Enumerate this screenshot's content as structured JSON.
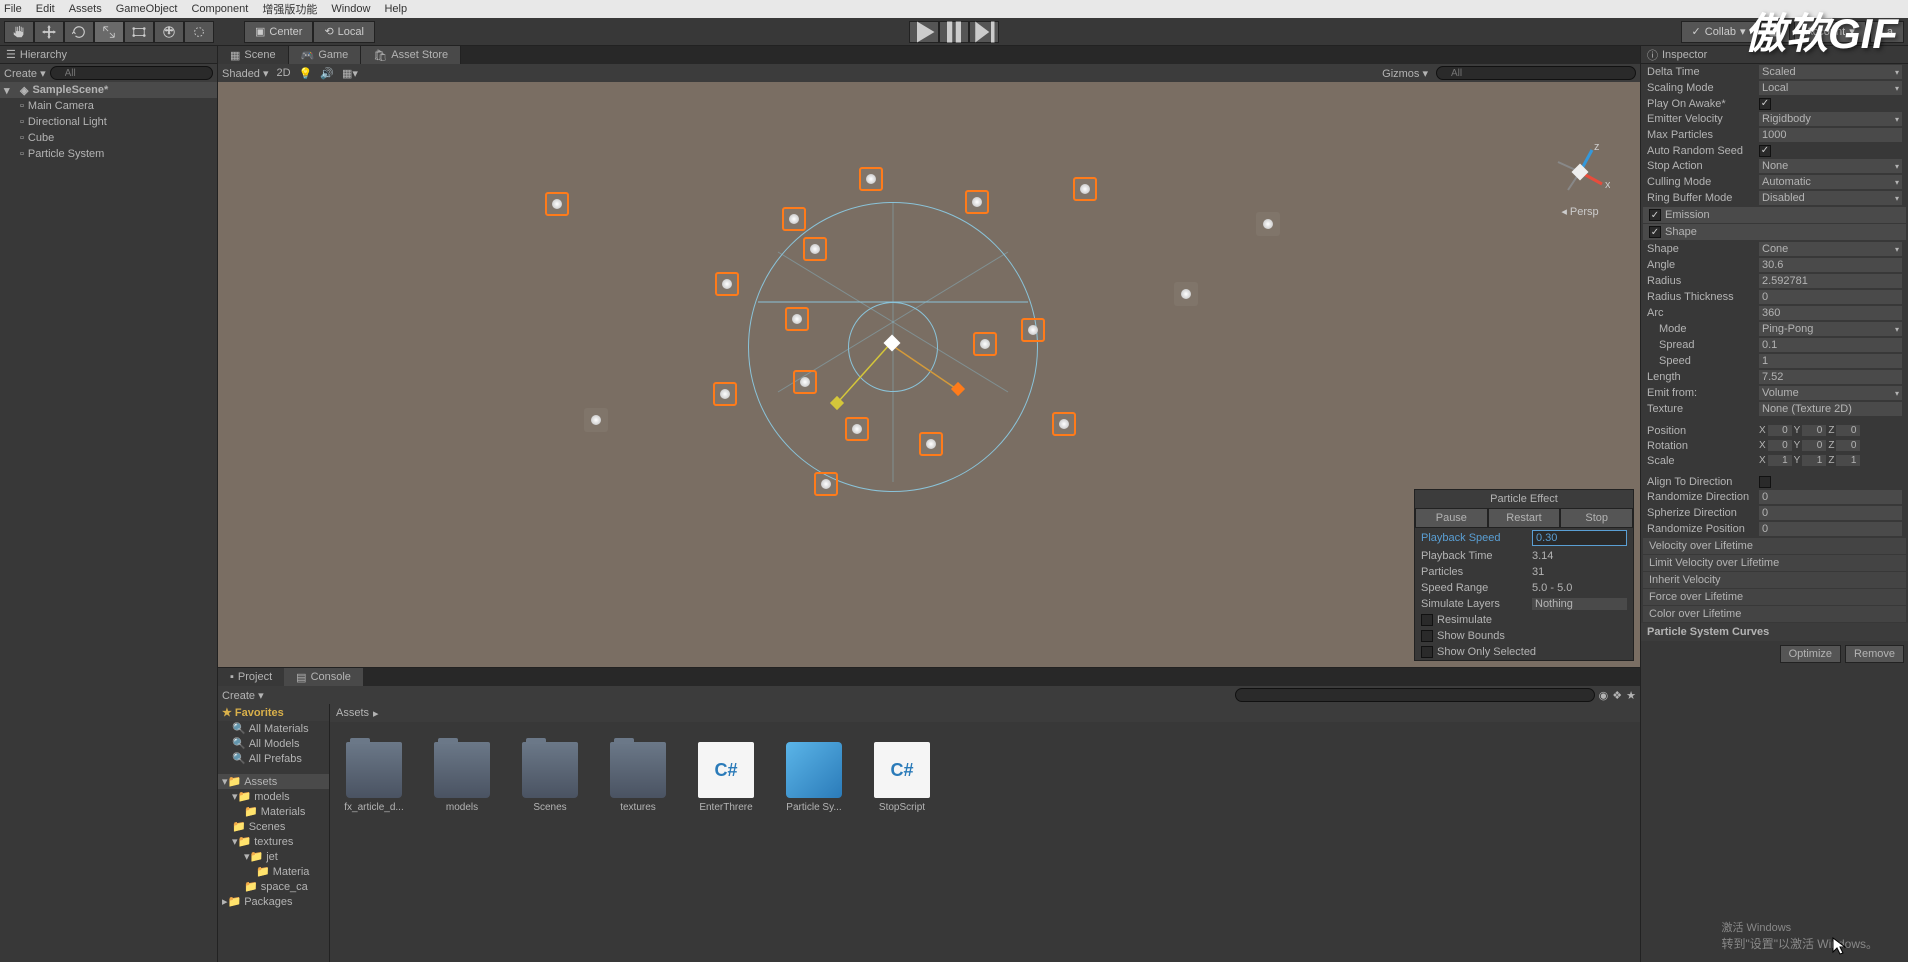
{
  "menubar": [
    "File",
    "Edit",
    "Assets",
    "GameObject",
    "Component",
    "增强版功能",
    "Window",
    "Help"
  ],
  "toolbar": {
    "center": "Center",
    "local": "Local",
    "collab": "Collab",
    "account": "Account",
    "layers": "La",
    "persp": "Persp"
  },
  "hierarchy": {
    "title": "Hierarchy",
    "create": "Create",
    "search_placeholder": "All",
    "scene": "SampleScene*",
    "items": [
      "Main Camera",
      "Directional Light",
      "Cube",
      "Particle System"
    ]
  },
  "center_tabs": {
    "scene": "Scene",
    "game": "Game",
    "asset_store": "Asset Store",
    "shaded": "Shaded",
    "mode_2d": "2D",
    "gizmos": "Gizmos",
    "search_all": "All"
  },
  "particle_effect": {
    "title": "Particle Effect",
    "pause": "Pause",
    "restart": "Restart",
    "stop": "Stop",
    "playback_speed_label": "Playback Speed",
    "playback_speed": "0.30",
    "playback_time_label": "Playback Time",
    "playback_time": "3.14",
    "particles_label": "Particles",
    "particles": "31",
    "speed_range_label": "Speed Range",
    "speed_range": "5.0 - 5.0",
    "simulate_layers_label": "Simulate Layers",
    "simulate_layers": "Nothing",
    "resimulate": "Resimulate",
    "show_bounds": "Show Bounds",
    "show_only_selected": "Show Only Selected"
  },
  "project": {
    "tab_project": "Project",
    "tab_console": "Console",
    "create": "Create",
    "favorites": "Favorites",
    "fav_items": [
      "All Materials",
      "All Models",
      "All Prefabs"
    ],
    "assets_root": "Assets",
    "tree": [
      {
        "label": "models",
        "indent": 1,
        "expanded": true
      },
      {
        "label": "Materials",
        "indent": 2
      },
      {
        "label": "Scenes",
        "indent": 1
      },
      {
        "label": "textures",
        "indent": 1,
        "expanded": true
      },
      {
        "label": "jet",
        "indent": 2,
        "expanded": true
      },
      {
        "label": "Materia",
        "indent": 3
      },
      {
        "label": "space_ca",
        "indent": 2
      }
    ],
    "packages": "Packages",
    "breadcrumb": "Assets",
    "assets": [
      {
        "name": "fx_article_d...",
        "type": "folder"
      },
      {
        "name": "models",
        "type": "folder"
      },
      {
        "name": "Scenes",
        "type": "folder"
      },
      {
        "name": "textures",
        "type": "folder"
      },
      {
        "name": "EnterThrere",
        "type": "script"
      },
      {
        "name": "Particle Sy...",
        "type": "cube"
      },
      {
        "name": "StopScript",
        "type": "script"
      }
    ]
  },
  "inspector": {
    "title": "Inspector",
    "delta_time": {
      "label": "Delta Time",
      "value": "Scaled"
    },
    "scaling_mode": {
      "label": "Scaling Mode",
      "value": "Local"
    },
    "play_on_awake": {
      "label": "Play On Awake*",
      "checked": true
    },
    "emitter_velocity": {
      "label": "Emitter Velocity",
      "value": "Rigidbody"
    },
    "max_particles": {
      "label": "Max Particles",
      "value": "1000"
    },
    "auto_random_seed": {
      "label": "Auto Random Seed",
      "checked": true
    },
    "stop_action": {
      "label": "Stop Action",
      "value": "None"
    },
    "culling_mode": {
      "label": "Culling Mode",
      "value": "Automatic"
    },
    "ring_buffer": {
      "label": "Ring Buffer Mode",
      "value": "Disabled"
    },
    "emission": "Emission",
    "shape_module": "Shape",
    "shape": {
      "label": "Shape",
      "value": "Cone"
    },
    "angle": {
      "label": "Angle",
      "value": "30.6"
    },
    "radius": {
      "label": "Radius",
      "value": "2.592781"
    },
    "radius_thickness": {
      "label": "Radius Thickness",
      "value": "0"
    },
    "arc": {
      "label": "Arc",
      "value": "360"
    },
    "arc_mode": {
      "label": "Mode",
      "value": "Ping-Pong"
    },
    "arc_spread": {
      "label": "Spread",
      "value": "0.1"
    },
    "arc_speed": {
      "label": "Speed",
      "value": "1"
    },
    "length": {
      "label": "Length",
      "value": "7.52"
    },
    "emit_from": {
      "label": "Emit from:",
      "value": "Volume"
    },
    "texture": {
      "label": "Texture",
      "value": "None (Texture 2D)"
    },
    "position": {
      "label": "Position",
      "x": "0",
      "y": "0",
      "z": "0"
    },
    "rotation": {
      "label": "Rotation",
      "x": "0",
      "y": "0",
      "z": "0"
    },
    "scale": {
      "label": "Scale",
      "x": "1",
      "y": "1",
      "z": "1"
    },
    "align_to_direction": {
      "label": "Align To Direction",
      "checked": false
    },
    "randomize_direction": {
      "label": "Randomize Direction",
      "value": "0"
    },
    "spherize_direction": {
      "label": "Spherize Direction",
      "value": "0"
    },
    "randomize_position": {
      "label": "Randomize Position",
      "value": "0"
    },
    "modules": [
      "Velocity over Lifetime",
      "Limit Velocity over Lifetime",
      "Inherit Velocity",
      "Force over Lifetime",
      "Color over Lifetime"
    ],
    "curves_title": "Particle System Curves",
    "optimize": "Optimize",
    "remove": "Remove"
  },
  "watermark": "傲软GIF",
  "windows_activate": {
    "title": "激活 Windows",
    "sub": "转到\"设置\"以激活 Windows。"
  }
}
